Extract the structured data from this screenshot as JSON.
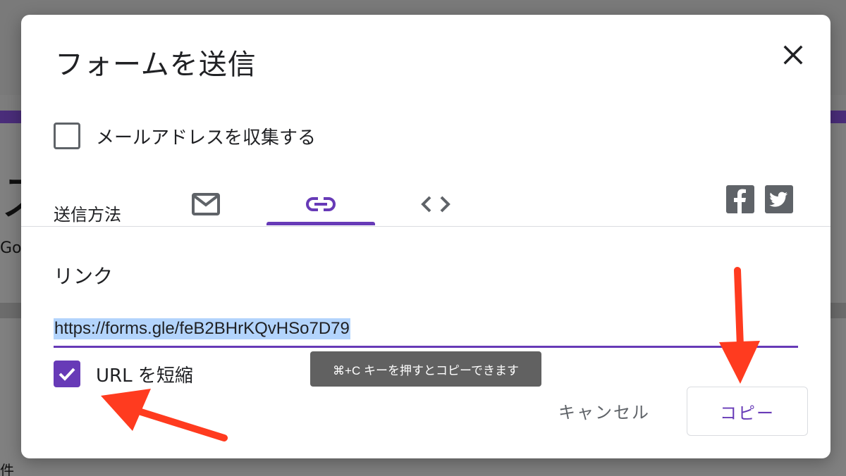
{
  "background": {
    "glyph_left": "ス",
    "text_left": "Goo",
    "text_bottom": "件"
  },
  "dialog": {
    "title": "フォームを送信",
    "close_icon": "close-icon"
  },
  "collect_email": {
    "label": "メールアドレスを収集する",
    "checked": false
  },
  "send_method": {
    "label": "送信方法",
    "tabs": [
      {
        "icon": "email-icon",
        "selected": false
      },
      {
        "icon": "link-icon",
        "selected": true
      },
      {
        "icon": "embed-code-icon",
        "selected": false
      }
    ],
    "social": [
      "facebook-icon",
      "twitter-icon"
    ]
  },
  "link_section": {
    "label": "リンク",
    "url": "https://forms.gle/feB2BHrKQvHSo7D79",
    "shorten_label": "URL を短縮",
    "shorten_checked": true
  },
  "tooltip": {
    "text": "⌘+C キーを押すとコピーできます"
  },
  "actions": {
    "cancel_label": "キャンセル",
    "copy_label": "コピー"
  },
  "colors": {
    "accent": "#673ab7",
    "annotation_arrow": "#ff3b1f"
  }
}
